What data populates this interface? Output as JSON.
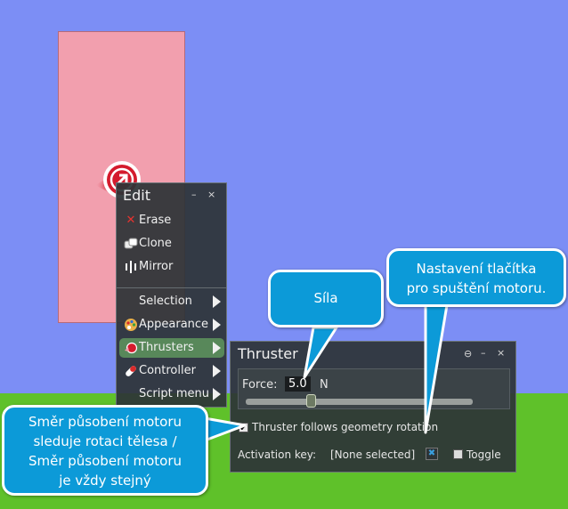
{
  "edit_panel": {
    "title": "Edit",
    "minimize": "–",
    "close": "×",
    "items": [
      {
        "label": "Erase",
        "icon": "erase-icon"
      },
      {
        "label": "Clone",
        "icon": "clone-icon"
      },
      {
        "label": "Mirror",
        "icon": "mirror-icon"
      }
    ],
    "submenus": [
      {
        "label": "Selection",
        "active": false
      },
      {
        "label": "Appearance",
        "active": false
      },
      {
        "label": "Thrusters",
        "active": true
      },
      {
        "label": "Controller",
        "active": false
      },
      {
        "label": "Script menu",
        "active": false
      }
    ]
  },
  "thruster_panel": {
    "title": "Thruster",
    "pin": "⊖",
    "minimize": "–",
    "close": "×",
    "force_label": "Force:",
    "force_value": "5.0",
    "force_unit": "N",
    "slider_fraction": 0.28,
    "follows_rotation_label": "Thruster follows geometry rotation",
    "follows_rotation_checked": true,
    "activation_key_label": "Activation key:",
    "activation_key_value": "[None selected]",
    "toggle_label": "Toggle",
    "toggle_checked": false
  },
  "callouts": {
    "force": "Síla",
    "activation": [
      "Nastavení tlačítka",
      "pro spuštění motoru."
    ],
    "direction": [
      "Směr působení motoru",
      "sleduje rotaci tělesa /",
      "Směr působení motoru",
      "je vždy stejný"
    ]
  },
  "colors": {
    "sky": "#7c8ef5",
    "ground": "#5fc12a",
    "box": "#f29fae",
    "callout": "#0c9ad8",
    "active_item": "#58885a"
  }
}
